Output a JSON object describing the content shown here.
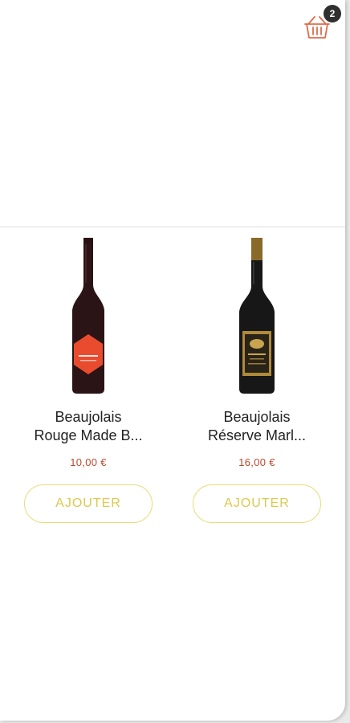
{
  "cart": {
    "icon": "basket-icon",
    "count": "2",
    "color": "#e06a4a"
  },
  "products": [
    {
      "name_line1": "Beaujolais",
      "name_line2": "Rouge Made B...",
      "price": "10,00 €",
      "button_label": "AJOUTER",
      "label_color": "#e94b2e"
    },
    {
      "name_line1": "Beaujolais",
      "name_line2": "Réserve Marl...",
      "price": "16,00 €",
      "button_label": "AJOUTER",
      "label_color": "#b08a3a"
    }
  ],
  "colors": {
    "accent": "#e8dc78",
    "price": "#b94a2c"
  }
}
